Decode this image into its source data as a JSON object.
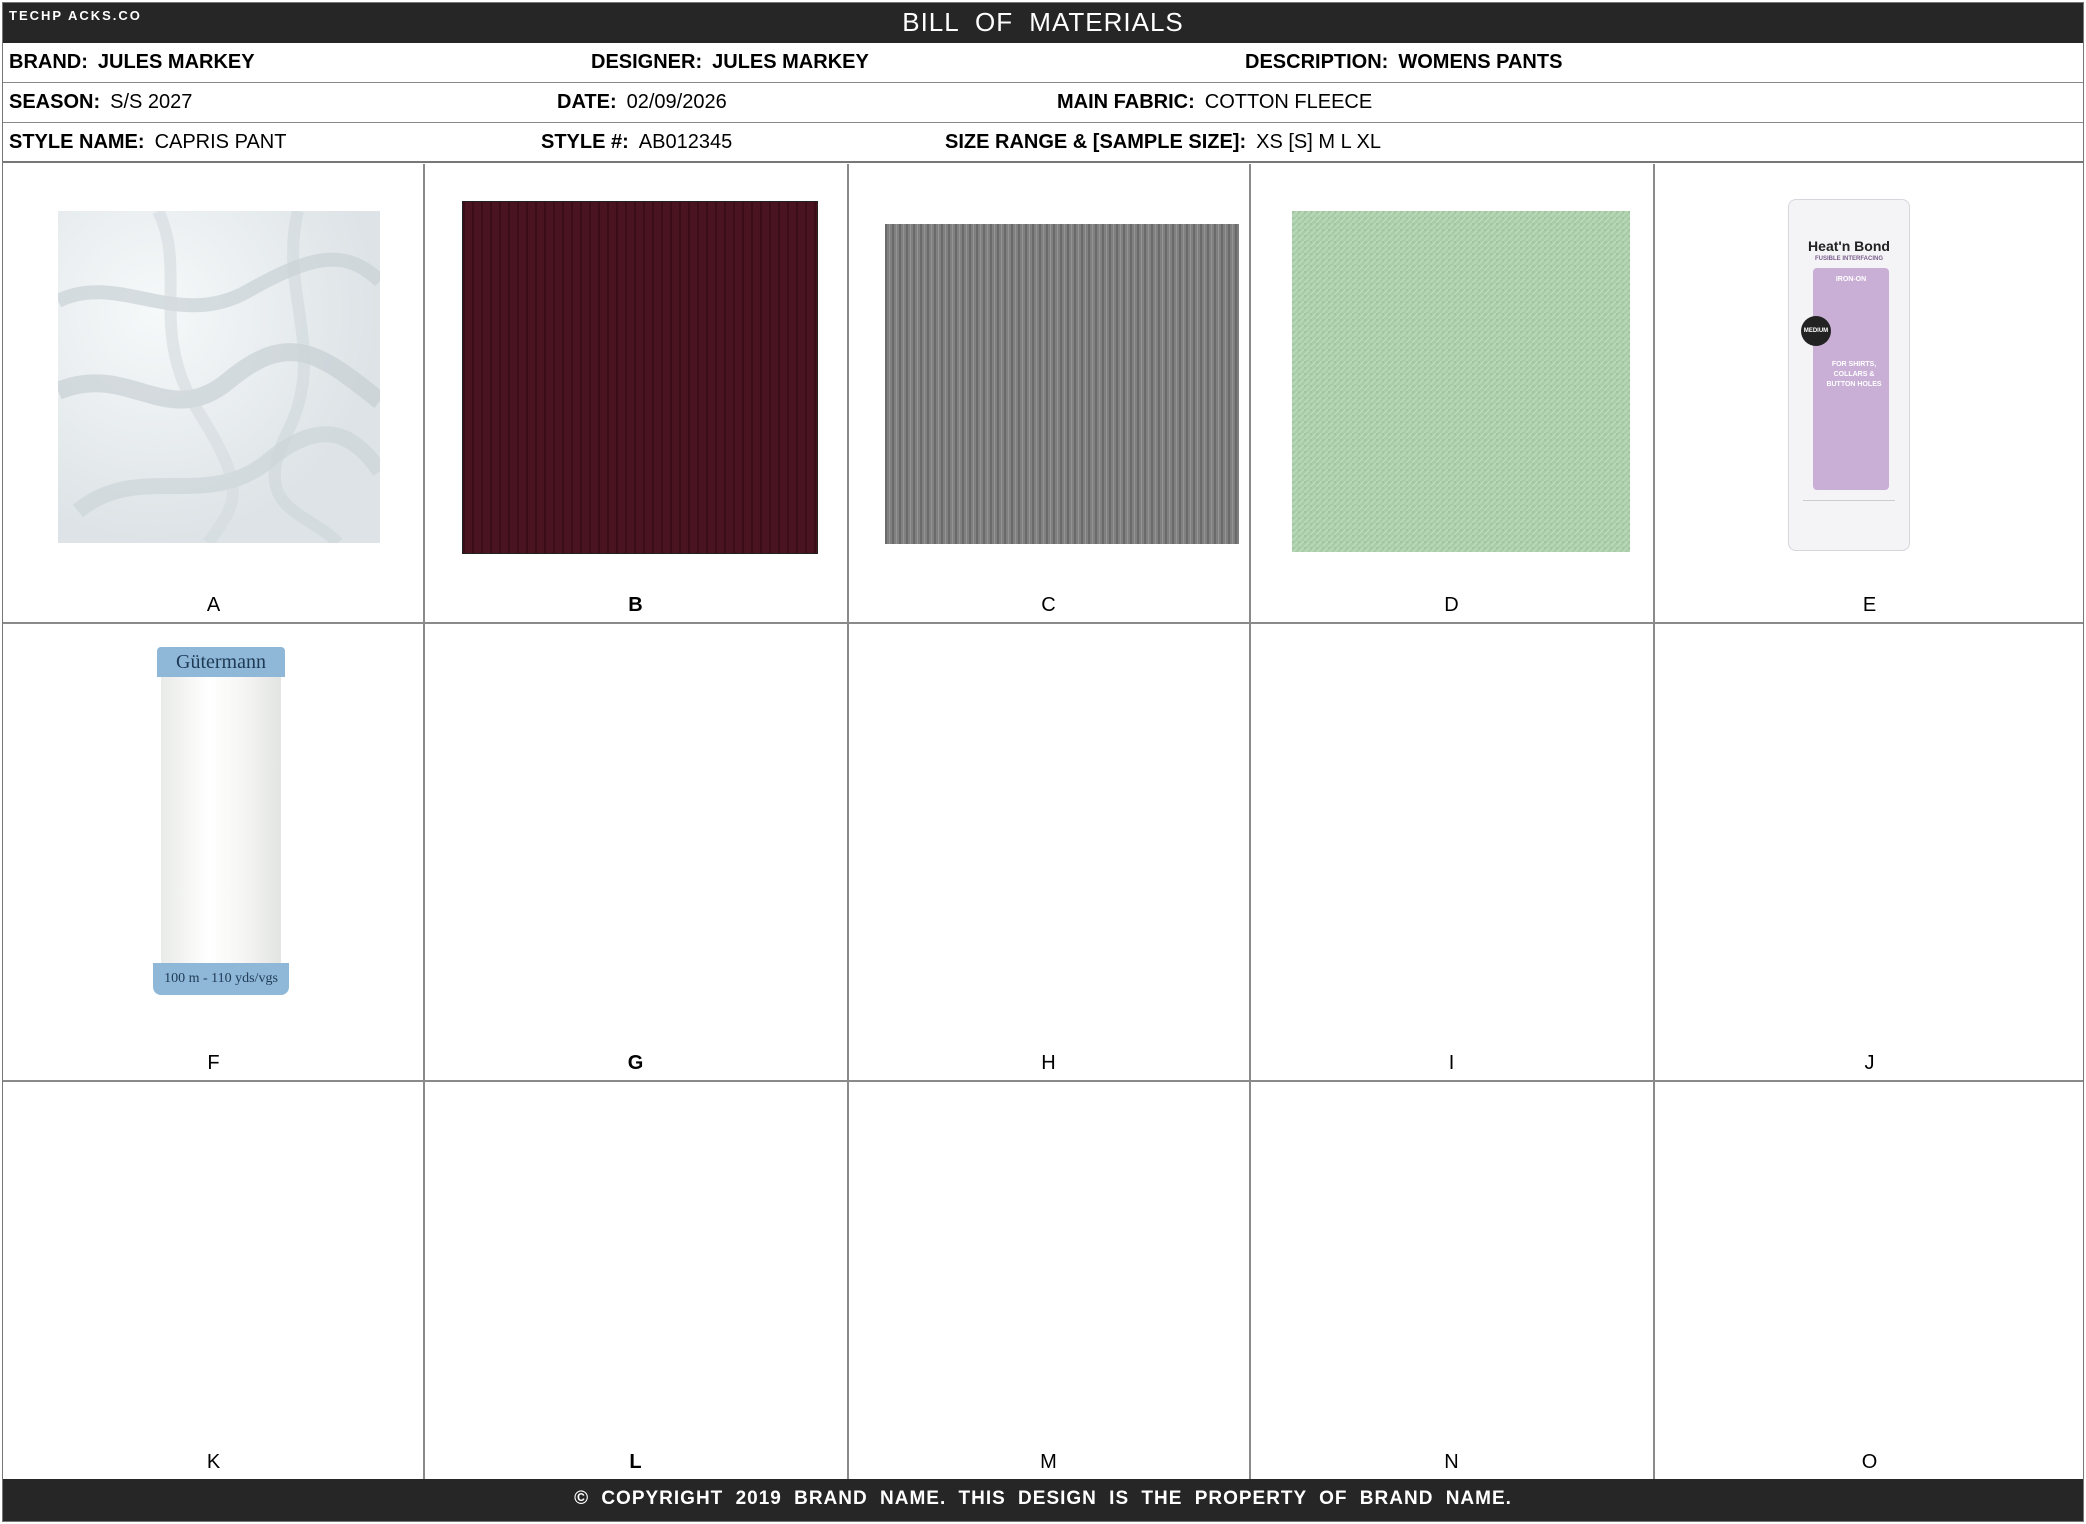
{
  "header": {
    "logo": "TECHP ACKS.CO",
    "title": "BILL  OF  MATERIALS"
  },
  "info": {
    "brand_label": "BRAND:",
    "brand_value": "JULES MARKEY",
    "designer_label": "DESIGNER:",
    "designer_value": "JULES MARKEY",
    "description_label": "DESCRIPTION:",
    "description_value": "WOMENS PANTS",
    "season_label": "SEASON:",
    "season_value": "S/S 2027",
    "date_label": "DATE:",
    "date_value": "02/09/2026",
    "main_fabric_label": "MAIN FABRIC:",
    "main_fabric_value": "COTTON FLEECE",
    "style_name_label": "STYLE NAME:",
    "style_name_value": "CAPRIS PANT",
    "style_num_label": "STYLE #:",
    "style_num_value": "AB012345",
    "size_range_label": "SIZE RANGE & [SAMPLE SIZE]:",
    "size_range_value": "XS  [S] M  L  XL"
  },
  "materials": [
    {
      "label": "A",
      "image": "white-cotton-fleece-swatch"
    },
    {
      "label": "B",
      "image": "burgundy-rib-knit-swatch"
    },
    {
      "label": "C",
      "image": "grey-rib-knit-swatch"
    },
    {
      "label": "D",
      "image": "mint-green-jersey-swatch"
    },
    {
      "label": "E",
      "image": "heat-n-bond-interfacing-package",
      "brand": "Heat'n Bond",
      "text": "FUSIBLE INTERFACING",
      "badge": "MEDIUM",
      "tag": "IRON-ON",
      "use": "FOR SHIRTS, COLLARS & BUTTON HOLES"
    },
    {
      "label": "F",
      "image": "gutermann-thread-spool",
      "brand": "Gütermann",
      "text": "100 m - 110 yds/vgs"
    },
    {
      "label": "G"
    },
    {
      "label": "H"
    },
    {
      "label": "I"
    },
    {
      "label": "J"
    },
    {
      "label": "K"
    },
    {
      "label": "L"
    },
    {
      "label": "M"
    },
    {
      "label": "N"
    },
    {
      "label": "O"
    }
  ],
  "colors": {
    "bar": "#262626",
    "burgundy": "#4a1320",
    "grey": "#7d7d7d",
    "mint": "#a9cda8",
    "lilac": "#c9afd6",
    "thread_label": "#8fb8d8"
  },
  "footer": {
    "text": "© COPYRIGHT 2019 BRAND NAME.  THIS DESIGN IS THE PROPERTY OF BRAND NAME."
  }
}
